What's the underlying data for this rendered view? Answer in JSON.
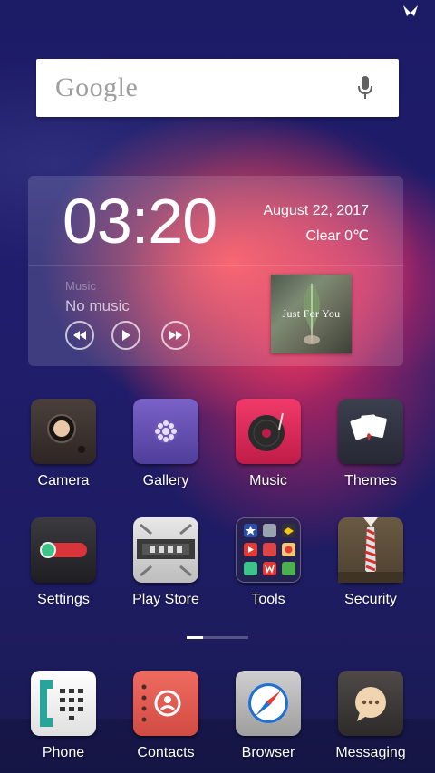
{
  "search": {
    "logo_text": "Google"
  },
  "widget": {
    "time": "03:20",
    "date": "August  22, 2017",
    "weather": "Clear  0℃",
    "music_label": "Music",
    "music_status": "No music",
    "album_title": "Just For You"
  },
  "apps": [
    {
      "label": "Camera"
    },
    {
      "label": "Gallery"
    },
    {
      "label": "Music"
    },
    {
      "label": "Themes"
    },
    {
      "label": "Settings"
    },
    {
      "label": "Play Store"
    },
    {
      "label": "Tools"
    },
    {
      "label": "Security"
    }
  ],
  "dock": [
    {
      "label": "Phone"
    },
    {
      "label": "Contacts"
    },
    {
      "label": "Browser"
    },
    {
      "label": "Messaging"
    }
  ],
  "colors": {
    "wallpaper_base": "#1c1b66",
    "wallpaper_accent": "#eb285f"
  }
}
